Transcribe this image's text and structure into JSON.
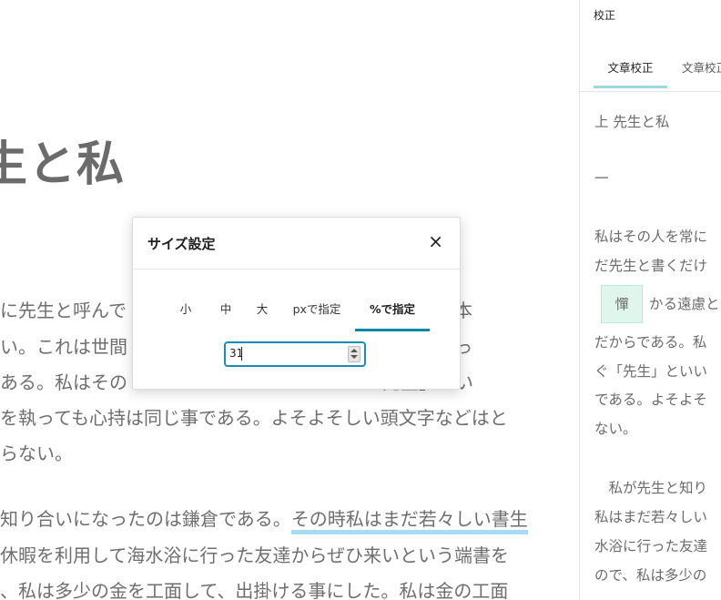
{
  "editor": {
    "heading": "生と私",
    "para1": [
      "に先生と呼んで　　　　　　　　　　　　　　くだけで本",
      "い。これは世間　　　　　　　　　　　　　　が私にとっ",
      "ある。私はその　　　　　　　　　　　　　　先生」とい",
      "を執っても心持は同じ事である。よそよそしい頭文字などはと",
      "らない。"
    ],
    "para2_line1_plain": "知り合いになったのは鎌倉である。",
    "para2_line1_highlight": "その時私はまだ若々しい書生",
    "para2": [
      "休暇を利用して海水浴に行った友達からぜひ来いという端書を",
      "、私は多少の金を工面して、出掛ける事にした。私は金の工面"
    ]
  },
  "modal": {
    "title": "サイズ設定",
    "close_icon": "×",
    "tabs": [
      "小",
      "中",
      "大",
      "pxで指定",
      "%で指定"
    ],
    "active_tab": "%で指定",
    "input_value": "31"
  },
  "sidebar": {
    "title": "校正",
    "tab_active": "文章校正",
    "tab_second": "文章校正",
    "lines": [
      "上 先生と私",
      "一",
      "私はその人を常に",
      "だ先生と書くだけ",
      "かる遠慮と",
      "だからである。私",
      "ぐ「先生」といい",
      "である。よそよそ",
      "ない。",
      "　私が先生と知り",
      "私はまだ若々しい",
      "水浴に行った友達",
      "ので、私は多少の"
    ],
    "badge": "憚",
    "colors": {
      "accent": "#0b87a6",
      "badge_bg": "#dff6ec",
      "highlight": "#a8dcf5"
    }
  }
}
